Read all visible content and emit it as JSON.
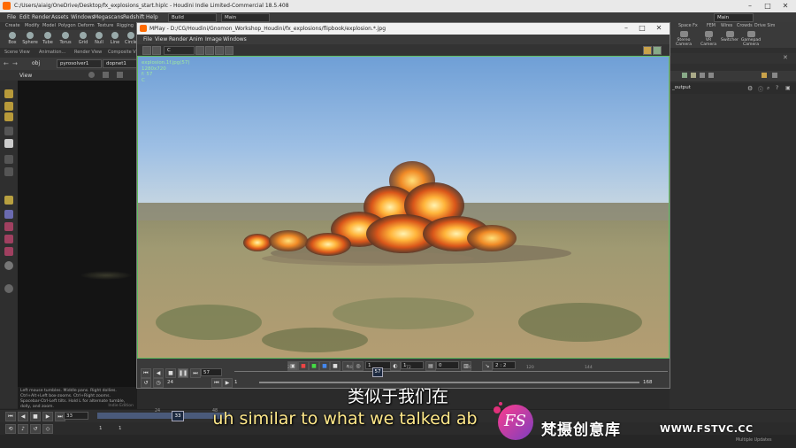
{
  "app": {
    "title": "C:/Users/aiaig/OneDrive/Desktop/fx_explosions_start.hiplc - Houdini Indie Limited-Commercial 18.5.408",
    "menu": [
      "File",
      "Edit",
      "Render",
      "Assets",
      "Windows",
      "Megascans",
      "Redshift",
      "Help"
    ],
    "build_dropdown": "Build",
    "desktop_dropdown": "Main",
    "right_desktop_dropdown": "Main"
  },
  "shelf": {
    "tabs": [
      "Create",
      "Modify",
      "Model",
      "Polygon",
      "Deform",
      "Texture",
      "Rigging"
    ],
    "tools": [
      "Box",
      "Sphere",
      "Tube",
      "Torus",
      "Grid",
      "Null",
      "Line",
      "Circle"
    ],
    "right_tabs": [
      "Space Fx",
      "FEM",
      "Wires",
      "Crowds",
      "Drive Sim"
    ],
    "right_tools": [
      "Stereo Camera",
      "VR Camera",
      "Switcher",
      "Gamepad Camera"
    ]
  },
  "panes": {
    "tabs": [
      "Scene View",
      "Animation...",
      "Render View",
      "Composite V"
    ],
    "path_obj": "obj",
    "node1": "pyrosolver1",
    "node2": "dopnet1",
    "view_label": "View",
    "right_path": "_output"
  },
  "viewport_hint": [
    "Left mouse tumbles. Middle pans. Right dollies. Ctrl+Alt+Left box-zooms. Ctrl+Right zooms.",
    "Spacebar-Ctrl-Left tilts. Hold L for alternate tumble, dolly, and zoom."
  ],
  "indie_label": "Indie Edition",
  "timeline": {
    "current_frame": "33",
    "frame_marker": "33",
    "start_a": "1",
    "start_b": "1",
    "ticks": [
      "24",
      "48"
    ],
    "tip": "Multiple Updates"
  },
  "mplay": {
    "title": "MPlay - D:/CG/Houdini/Gnomon_Workshop_Houdini/fx_explosions/flipbook/explosion.*.jpg",
    "menu": [
      "File",
      "View",
      "Render",
      "Anim",
      "Image",
      "Windows"
    ],
    "channel": "C",
    "image_info": [
      "explosion.1f.jpg(57)",
      "1280x720",
      "f: 57",
      "C"
    ],
    "controls": {
      "frame": "57",
      "step": "24",
      "start": "1",
      "end": "168",
      "marker": "57",
      "f1": "1",
      "f2": "1",
      "f3": "0",
      "ratio": "2 : 2",
      "ruler_ticks": [
        "24",
        "48",
        "72",
        "96",
        "120",
        "144"
      ]
    }
  },
  "subtitles": {
    "cn": "类似于我们在",
    "en": "uh similar to what we talked ab"
  },
  "watermark": {
    "logo_text": "FS",
    "brand": "梵摄创意库",
    "url": "WWW.FSTVC.CC"
  },
  "colors": {
    "houdini_orange": "#ff6a00",
    "green_frame": "#5fbf5f",
    "subtitle_yellow": "#ffe88a",
    "logo_pink": "#e0307a",
    "logo_purple": "#7b3fc0"
  }
}
